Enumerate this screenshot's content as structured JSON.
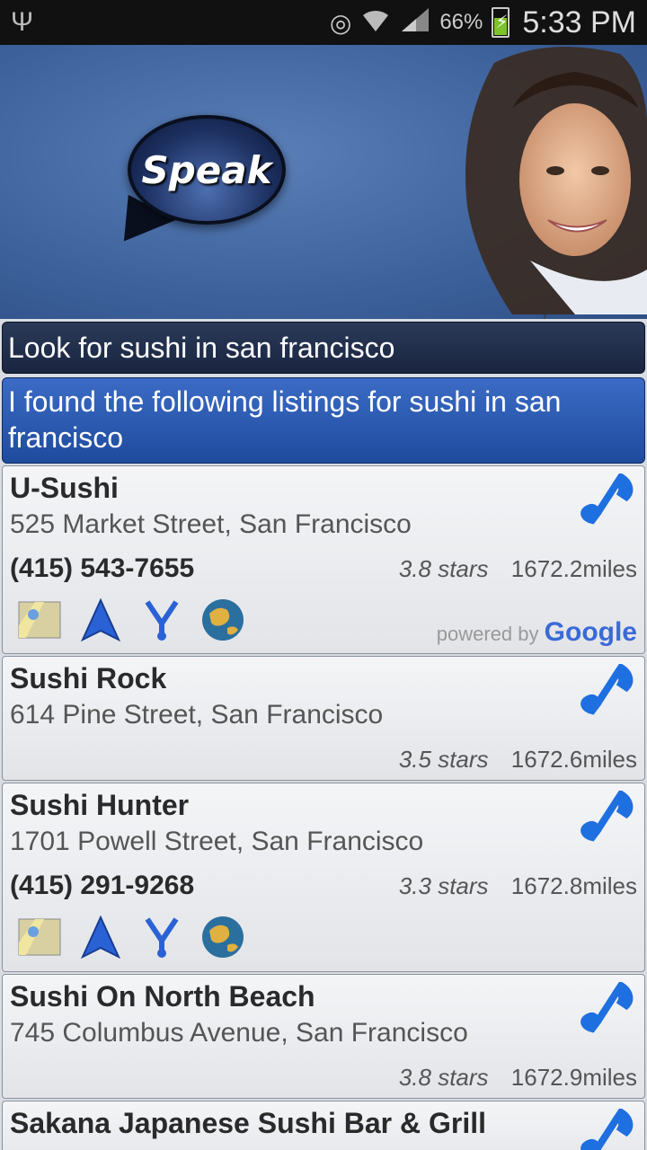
{
  "status_bar": {
    "battery_percent": "66%",
    "time": "5:33 PM"
  },
  "header": {
    "speak_label": "Speak"
  },
  "query_text": "Look for sushi in san francisco",
  "response_text": "I found the following listings for sushi in san francisco",
  "powered_by": {
    "prefix": "powered by",
    "brand": "Google"
  },
  "listings": [
    {
      "name": "U-Sushi",
      "address": "525 Market Street, San Francisco",
      "phone": "(415) 543-7655",
      "stars": "3.8 stars",
      "distance": "1672.2miles"
    },
    {
      "name": "Sushi Rock",
      "address": "614 Pine Street, San Francisco",
      "phone": "",
      "stars": "3.5 stars",
      "distance": "1672.6miles"
    },
    {
      "name": "Sushi Hunter",
      "address": "1701 Powell Street, San Francisco",
      "phone": "(415) 291-9268",
      "stars": "3.3 stars",
      "distance": "1672.8miles"
    },
    {
      "name": "Sushi On North Beach",
      "address": "745 Columbus Avenue, San Francisco",
      "phone": "",
      "stars": "3.8 stars",
      "distance": "1672.9miles"
    },
    {
      "name": "Sakana Japanese Sushi Bar & Grill",
      "address": "",
      "phone": "",
      "stars": "",
      "distance": ""
    }
  ],
  "colors": {
    "header_bg": "#3f649e",
    "query_bg": "#1a2540",
    "response_bg": "#2a58b0",
    "call_icon": "#1e6fe0"
  }
}
